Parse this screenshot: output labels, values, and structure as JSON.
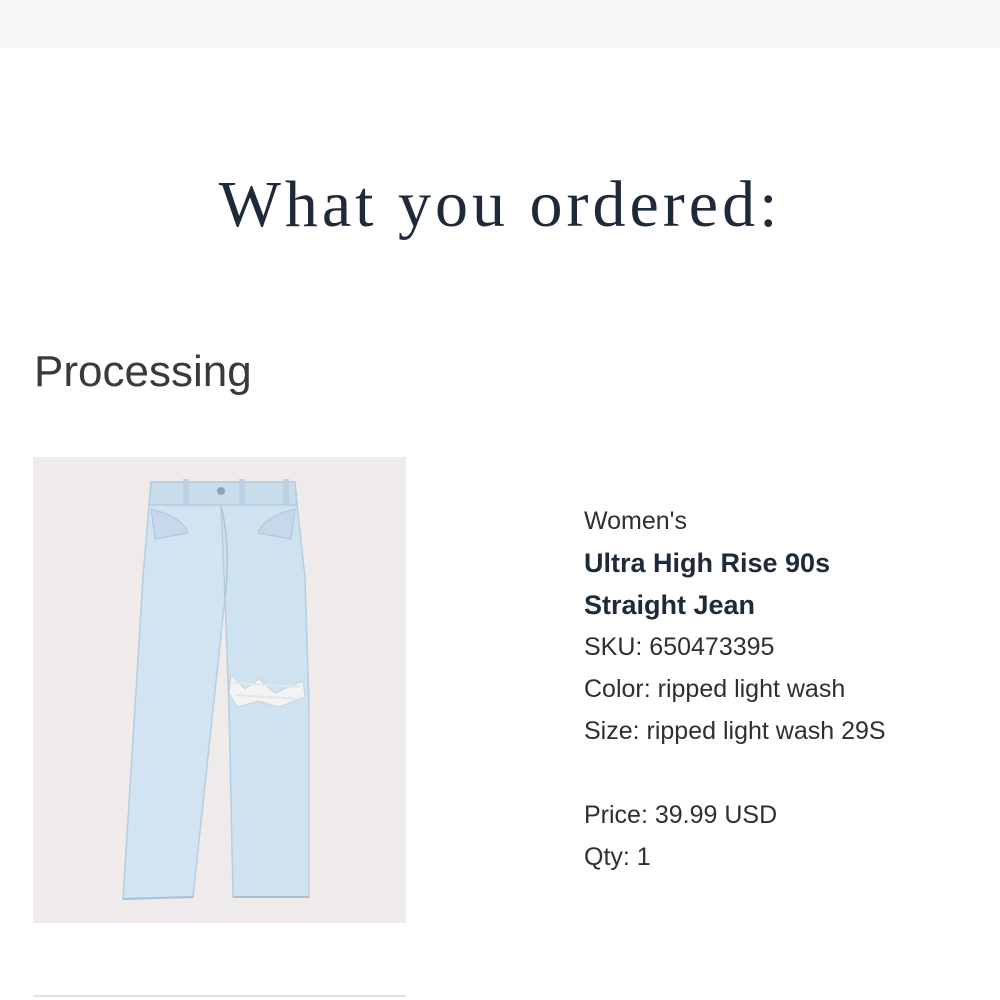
{
  "page": {
    "title": "What you ordered:"
  },
  "order": {
    "status": "Processing"
  },
  "item": {
    "category": "Women's",
    "name_line1": "Ultra High Rise 90s",
    "name_line2": "Straight Jean",
    "sku": "SKU: 650473395",
    "color": "Color: ripped light wash",
    "size": "Size: ripped light wash 29S",
    "price": "Price: 39.99 USD",
    "qty": "Qty: 1",
    "image_icon": "jeans-product-image"
  },
  "colors": {
    "title": "#1e2a3a",
    "denim": "#cfe1ee",
    "image_bg": "#efebea"
  }
}
